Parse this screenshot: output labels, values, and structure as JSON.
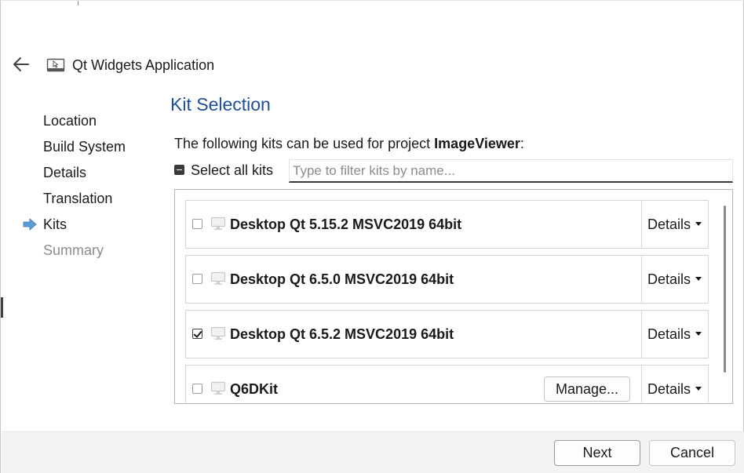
{
  "header": {
    "title": "Qt Widgets Application",
    "back_icon": "arrow-left-icon",
    "app_icon": "window-cursor-icon"
  },
  "steps": [
    {
      "label": "Location",
      "state": "done"
    },
    {
      "label": "Build System",
      "state": "done"
    },
    {
      "label": "Details",
      "state": "done"
    },
    {
      "label": "Translation",
      "state": "done"
    },
    {
      "label": "Kits",
      "state": "current"
    },
    {
      "label": "Summary",
      "state": "pending"
    }
  ],
  "main": {
    "heading": "Kit Selection",
    "intro_prefix": "The following kits can be used for project ",
    "project_name": "ImageViewer",
    "intro_suffix": ":",
    "select_all_label": "Select all kits",
    "filter_placeholder": "Type to filter kits by name...",
    "filter_value": ""
  },
  "kits": [
    {
      "name": "Desktop Qt 5.15.2 MSVC2019 64bit",
      "checked": false,
      "details_label": "Details"
    },
    {
      "name": "Desktop Qt 6.5.0 MSVC2019 64bit",
      "checked": false,
      "details_label": "Details"
    },
    {
      "name": "Desktop Qt 6.5.2 MSVC2019 64bit",
      "checked": true,
      "details_label": "Details"
    },
    {
      "name": "Q6DKit",
      "checked": false,
      "details_label": "Details",
      "manage_label": "Manage..."
    }
  ],
  "footer": {
    "next_label": "Next",
    "cancel_label": "Cancel"
  },
  "colors": {
    "heading": "#1f4e99",
    "current_step_arrow": "#5b9bd5",
    "footer_bg": "#f3f3f3",
    "disabled_text": "#8c8c8c"
  }
}
